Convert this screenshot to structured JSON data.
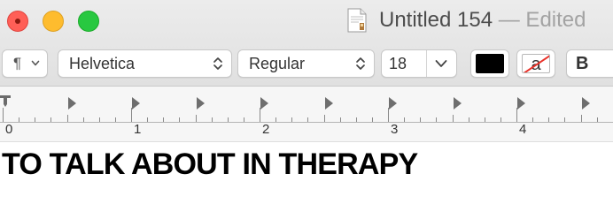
{
  "window": {
    "title": "Untitled 154",
    "title_suffix": " — Edited",
    "icons": [
      "close-icon",
      "minimize-icon",
      "zoom-icon",
      "document-icon"
    ]
  },
  "toolbar": {
    "paragraph_symbol": "¶",
    "font_family": "Helvetica",
    "font_style": "Regular",
    "font_size": "18",
    "text_color": "#000000",
    "highlight_label": "a",
    "bold_label": "B"
  },
  "ruler": {
    "numbers": [
      "0",
      "1",
      "2",
      "3",
      "4"
    ]
  },
  "document": {
    "text": "TO TALK ABOUT IN THERAPY"
  },
  "colors": {
    "close": "#ff5f57",
    "minimize": "#febc2e",
    "zoom": "#28c840",
    "strike": "#e8322a"
  }
}
